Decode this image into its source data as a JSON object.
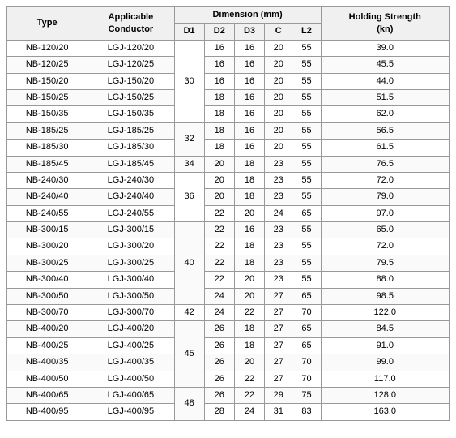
{
  "table": {
    "headers": {
      "row1": [
        "Type",
        "Applicable Conductor",
        "Dimension (mm)",
        "",
        "",
        "",
        "",
        "Holding Strength (kn)"
      ],
      "row2": [
        "",
        "",
        "D1",
        "D2",
        "D3",
        "C",
        "L2",
        ""
      ]
    },
    "rows": [
      {
        "type": "NB-120/20",
        "conductor": "LGJ-120/20",
        "d1": "30",
        "d2": "16",
        "d3": "16",
        "c": "20",
        "l2": "55",
        "hs": "39.0",
        "d1_show": true
      },
      {
        "type": "NB-120/25",
        "conductor": "LGJ-120/25",
        "d1": "",
        "d2": "16",
        "d3": "16",
        "c": "20",
        "l2": "55",
        "hs": "45.5",
        "d1_show": false
      },
      {
        "type": "NB-150/20",
        "conductor": "LGJ-150/20",
        "d1": "",
        "d2": "16",
        "d3": "16",
        "c": "20",
        "l2": "55",
        "hs": "44.0",
        "d1_show": false
      },
      {
        "type": "NB-150/25",
        "conductor": "LGJ-150/25",
        "d1": "",
        "d2": "18",
        "d3": "16",
        "c": "20",
        "l2": "55",
        "hs": "51.5",
        "d1_show": false
      },
      {
        "type": "NB-150/35",
        "conductor": "LGJ-150/35",
        "d1": "",
        "d2": "18",
        "d3": "16",
        "c": "20",
        "l2": "55",
        "hs": "62.0",
        "d1_show": false
      },
      {
        "type": "NB-185/25",
        "conductor": "LGJ-185/25",
        "d1": "32",
        "d2": "18",
        "d3": "16",
        "c": "20",
        "l2": "55",
        "hs": "56.5",
        "d1_show": true
      },
      {
        "type": "NB-185/30",
        "conductor": "LGJ-185/30",
        "d1": "",
        "d2": "18",
        "d3": "16",
        "c": "20",
        "l2": "55",
        "hs": "61.5",
        "d1_show": false
      },
      {
        "type": "NB-185/45",
        "conductor": "LGJ-185/45",
        "d1": "34",
        "d2": "20",
        "d3": "18",
        "c": "23",
        "l2": "55",
        "hs": "76.5",
        "d1_show": true
      },
      {
        "type": "NB-240/30",
        "conductor": "LGJ-240/30",
        "d1": "36",
        "d2": "20",
        "d3": "18",
        "c": "23",
        "l2": "55",
        "hs": "72.0",
        "d1_show": true
      },
      {
        "type": "NB-240/40",
        "conductor": "LGJ-240/40",
        "d1": "",
        "d2": "20",
        "d3": "18",
        "c": "23",
        "l2": "55",
        "hs": "79.0",
        "d1_show": false
      },
      {
        "type": "NB-240/55",
        "conductor": "LGJ-240/55",
        "d1": "",
        "d2": "22",
        "d3": "20",
        "c": "24",
        "l2": "65",
        "hs": "97.0",
        "d1_show": false
      },
      {
        "type": "NB-300/15",
        "conductor": "LGJ-300/15",
        "d1": "40",
        "d2": "22",
        "d3": "16",
        "c": "23",
        "l2": "55",
        "hs": "65.0",
        "d1_show": true
      },
      {
        "type": "NB-300/20",
        "conductor": "LGJ-300/20",
        "d1": "",
        "d2": "22",
        "d3": "18",
        "c": "23",
        "l2": "55",
        "hs": "72.0",
        "d1_show": false
      },
      {
        "type": "NB-300/25",
        "conductor": "LGJ-300/25",
        "d1": "",
        "d2": "22",
        "d3": "18",
        "c": "23",
        "l2": "55",
        "hs": "79.5",
        "d1_show": false
      },
      {
        "type": "NB-300/40",
        "conductor": "LGJ-300/40",
        "d1": "",
        "d2": "22",
        "d3": "20",
        "c": "23",
        "l2": "55",
        "hs": "88.0",
        "d1_show": false
      },
      {
        "type": "NB-300/50",
        "conductor": "LGJ-300/50",
        "d1": "",
        "d2": "24",
        "d3": "20",
        "c": "27",
        "l2": "65",
        "hs": "98.5",
        "d1_show": false
      },
      {
        "type": "NB-300/70",
        "conductor": "LGJ-300/70",
        "d1": "42",
        "d2": "24",
        "d3": "22",
        "c": "27",
        "l2": "70",
        "hs": "122.0",
        "d1_show": true
      },
      {
        "type": "NB-400/20",
        "conductor": "LGJ-400/20",
        "d1": "45",
        "d2": "26",
        "d3": "18",
        "c": "27",
        "l2": "65",
        "hs": "84.5",
        "d1_show": true
      },
      {
        "type": "NB-400/25",
        "conductor": "LGJ-400/25",
        "d1": "",
        "d2": "26",
        "d3": "18",
        "c": "27",
        "l2": "65",
        "hs": "91.0",
        "d1_show": false
      },
      {
        "type": "NB-400/35",
        "conductor": "LGJ-400/35",
        "d1": "",
        "d2": "26",
        "d3": "20",
        "c": "27",
        "l2": "70",
        "hs": "99.0",
        "d1_show": false
      },
      {
        "type": "NB-400/50",
        "conductor": "LGJ-400/50",
        "d1": "",
        "d2": "26",
        "d3": "22",
        "c": "27",
        "l2": "70",
        "hs": "117.0",
        "d1_show": false
      },
      {
        "type": "NB-400/65",
        "conductor": "LGJ-400/65",
        "d1": "48",
        "d2": "26",
        "d3": "22",
        "c": "29",
        "l2": "75",
        "hs": "128.0",
        "d1_show": true
      },
      {
        "type": "NB-400/95",
        "conductor": "LGJ-400/95",
        "d1": "",
        "d2": "28",
        "d3": "24",
        "c": "31",
        "l2": "83",
        "hs": "163.0",
        "d1_show": false
      }
    ]
  }
}
